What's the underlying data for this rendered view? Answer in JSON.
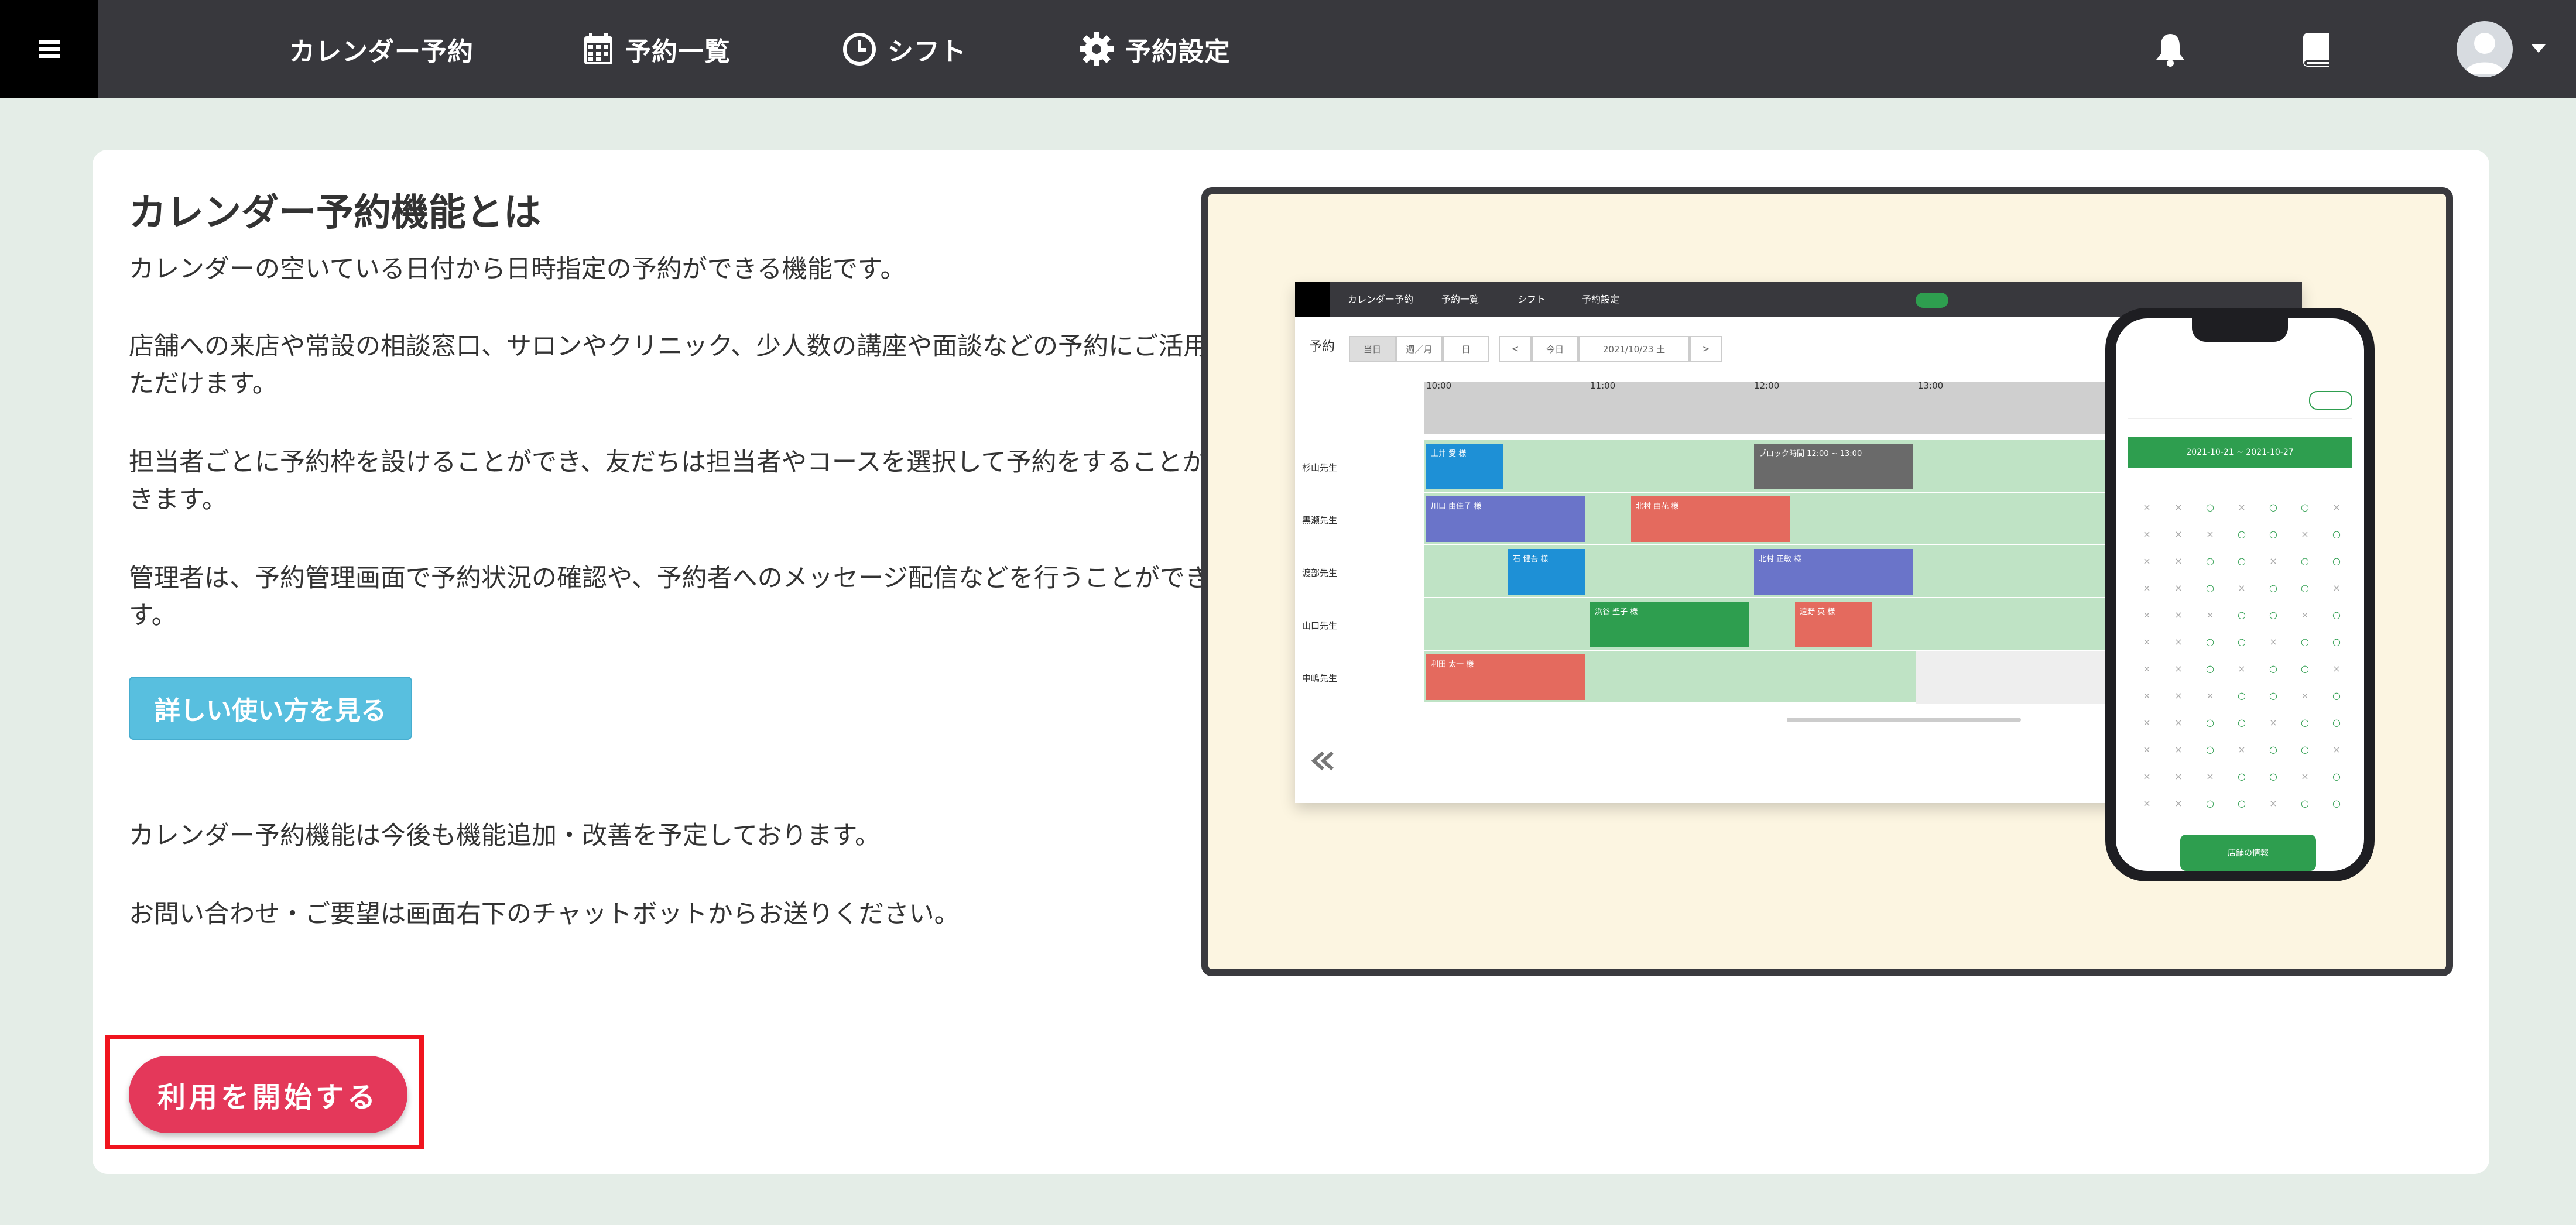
{
  "header": {
    "menu_icon": "hamburger-icon",
    "nav": [
      {
        "label": "カレンダー予約",
        "icon": ""
      },
      {
        "label": "予約一覧",
        "icon": "calendar-icon"
      },
      {
        "label": "シフト",
        "icon": "clock-icon"
      },
      {
        "label": "予約設定",
        "icon": "gear-icon"
      }
    ],
    "notification_icon": "bell-icon",
    "manual_icon": "book-icon",
    "avatar_icon": "user-avatar-icon"
  },
  "main": {
    "title": "カレンダー予約機能とは",
    "paragraphs": [
      "カレンダーの空いている日付から日時指定の予約ができる機能です。",
      "店舗への来店や常設の相談窓口、サロンやクリニック、少人数の講座や面談などの予約にご活用いただけます。",
      "担当者ごとに予約枠を設けることができ、友だちは担当者やコースを選択して予約をすることができます。",
      "管理者は、予約管理画面で予約状況の確認や、予約者へのメッセージ配信などを行うことができます。"
    ],
    "help_button": "詳しい使い方を見る",
    "notes": [
      "カレンダー予約機能は今後も機能追加・改善を予定しております。",
      "お問い合わせ・ご要望は画面右下のチャットボットからお送りください。"
    ],
    "start_button": "利用を開始する"
  },
  "preview": {
    "nav": [
      "カレンダー予約",
      "予約一覧",
      "シフト",
      "予約設定"
    ],
    "toolbar_label": "予約",
    "pills": [
      "当日",
      "週／月",
      "日",
      "<",
      "今日",
      "2021/10/23 土",
      ">"
    ],
    "times": [
      "10:00",
      "11:00",
      "12:00",
      "13:00"
    ],
    "rows": [
      "杉山先生",
      "黒瀬先生",
      "渡部先生",
      "山口先生",
      "中嶋先生"
    ],
    "events": [
      {
        "label": "上井 愛 様",
        "row": 0,
        "start": 0,
        "span": 0.5,
        "color": "#1e90d6"
      },
      {
        "label": "ブロック時間 12:00 ~ 13:00",
        "row": 0,
        "start": 2,
        "span": 1,
        "color": "#6a6a6a"
      },
      {
        "label": "川口 由佳子 様",
        "row": 1,
        "start": 0,
        "span": 1,
        "color": "#6a74c9"
      },
      {
        "label": "北村 由花 様",
        "row": 1,
        "start": 1.25,
        "span": 1,
        "color": "#e46a5e"
      },
      {
        "label": "石 健吾 様",
        "row": 2,
        "start": 0.5,
        "span": 0.5,
        "color": "#1e90d6"
      },
      {
        "label": "北村 正敏 様",
        "row": 2,
        "start": 2,
        "span": 1,
        "color": "#6a74c9"
      },
      {
        "label": "浜谷 聖子 様",
        "row": 3,
        "start": 1,
        "span": 1,
        "color": "#2e9e4f"
      },
      {
        "label": "遠野 英 様",
        "row": 3,
        "start": 2.25,
        "span": 0.5,
        "color": "#e46a5e"
      },
      {
        "label": "利田 太一 様",
        "row": 4,
        "start": 0,
        "span": 1,
        "color": "#e46a5e"
      }
    ],
    "phone_range": "2021-10-21 ~ 2021-10-27",
    "phone_button": "店舗の情報",
    "collapse_icon": "double-chevron-left-icon"
  }
}
